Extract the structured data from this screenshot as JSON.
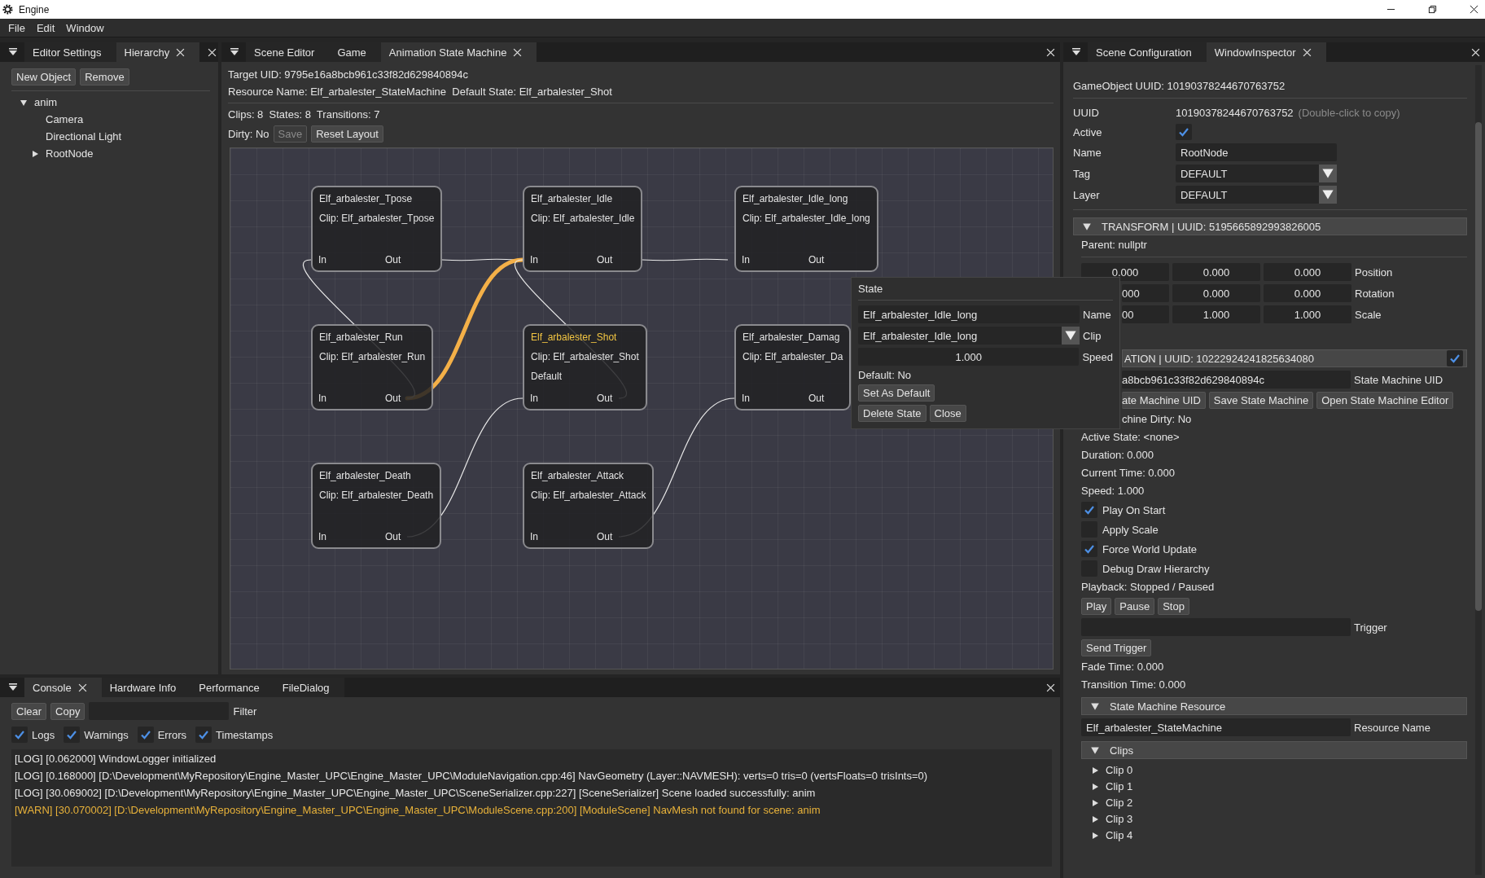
{
  "window": {
    "title": "Engine"
  },
  "menu": [
    "File",
    "Edit",
    "Window"
  ],
  "left_panel": {
    "tabs": [
      {
        "label": "Editor Settings",
        "selected": false,
        "closable": false
      },
      {
        "label": "Hierarchy",
        "selected": true,
        "closable": true
      }
    ],
    "buttons": [
      "New Object",
      "Remove"
    ],
    "tree": [
      {
        "label": "anim",
        "expanded": true,
        "children": [
          {
            "label": "Camera"
          },
          {
            "label": "Directional Light"
          },
          {
            "label": "RootNode",
            "expanded": false
          }
        ]
      }
    ]
  },
  "center_panel": {
    "tabs": [
      {
        "label": "Scene Editor",
        "selected": false,
        "closable": false
      },
      {
        "label": "Game",
        "selected": false,
        "closable": false
      },
      {
        "label": "Animation State Machine",
        "selected": true,
        "closable": true
      }
    ],
    "target_uid": "Target UID: 9795e16a8bcb961c33f82d629840894c",
    "resource_line": "Resource Name: Elf_arbalester_StateMachine  Default State: Elf_arbalester_Shot",
    "counts": "Clips: 8  States: 8  Transitions: 7",
    "dirty": "Dirty: No",
    "buttons": [
      {
        "label": "Save",
        "disabled": true
      },
      {
        "label": "Reset Layout",
        "disabled": false
      }
    ],
    "graph": {
      "nodes": [
        {
          "name": "Elf_arbalester_Tpose",
          "clip": "Clip: Elf_arbalester_Tpose",
          "highlighted": false,
          "in": "In",
          "out": "Out"
        },
        {
          "name": "Elf_arbalester_Idle",
          "clip": "Clip: Elf_arbalester_Idle",
          "highlighted": false,
          "in": "In",
          "out": "Out"
        },
        {
          "name": "Elf_arbalester_Idle_long",
          "clip": "Clip: Elf_arbalester_Idle_long",
          "highlighted": false,
          "in": "In",
          "out": "Out"
        },
        {
          "name": "Elf_arbalester_Run",
          "clip": "Clip: Elf_arbalester_Run",
          "highlighted": false,
          "in": "In",
          "out": "Out"
        },
        {
          "name": "Elf_arbalester_Shot",
          "clip": "Clip: Elf_arbalester_Shot",
          "note": "Default",
          "highlighted": true,
          "in": "In",
          "out": "Out"
        },
        {
          "name": "Elf_arbalester_Damag",
          "clip": "Clip: Elf_arbalester_Da",
          "highlighted": false,
          "in": "In",
          "out": "Out"
        },
        {
          "name": "Elf_arbalester_Death",
          "clip": "Clip: Elf_arbalester_Death",
          "highlighted": false,
          "in": "In",
          "out": "Out"
        },
        {
          "name": "Elf_arbalester_Attack",
          "clip": "Clip: Elf_arbalester_Attack",
          "highlighted": false,
          "in": "In",
          "out": "Out"
        }
      ],
      "transitions": [
        {
          "selected": false
        },
        {
          "selected": false
        },
        {
          "selected": true
        },
        {
          "selected": false
        },
        {
          "selected": false
        },
        {
          "selected": false
        },
        {
          "selected": false
        }
      ]
    }
  },
  "state_popup": {
    "title": "State",
    "name_value": "Elf_arbalester_Idle_long",
    "name_label": "Name",
    "clip_value": "Elf_arbalester_Idle_long",
    "clip_label": "Clip",
    "speed_value": "1.000",
    "speed_label": "Speed",
    "default_text": "Default: No",
    "buttons": [
      "Set As Default",
      "Delete State",
      "Close"
    ]
  },
  "right_panel": {
    "tabs": [
      {
        "label": "Scene Configuration",
        "selected": false,
        "closable": false
      },
      {
        "label": "WindowInspector",
        "selected": true,
        "closable": true
      }
    ],
    "gameobject_uuid": "GameObject UUID: 10190378244670763752",
    "uuid": {
      "label": "UUID",
      "value": "10190378244670763752",
      "hint": "(Double-click to copy)"
    },
    "active": {
      "label": "Active",
      "checked": true
    },
    "name": {
      "label": "Name",
      "value": "RootNode"
    },
    "tag": {
      "label": "Tag",
      "value": "DEFAULT"
    },
    "layer": {
      "label": "Layer",
      "value": "DEFAULT"
    },
    "transform": {
      "title": "TRANSFORM | UUID: 5195665892993826005",
      "expanded": true,
      "parent": "Parent: nullptr",
      "rows": [
        {
          "label": "Position",
          "values": [
            "0.000",
            "0.000",
            "0.000"
          ]
        },
        {
          "label": "Rotation",
          "values": [
            "000",
            "0.000",
            "0.000"
          ]
        },
        {
          "label": "Scale",
          "values": [
            "00",
            "1.000",
            "1.000"
          ]
        }
      ]
    },
    "animation": {
      "title": "ATION | UUID: 10222924241825634080",
      "enabled": true,
      "uid_value": "a8bcb961c33f82d629840894c",
      "uid_label": "State Machine UID",
      "buttons": [
        "ate Machine UID",
        "Save State Machine",
        "Open State Machine Editor"
      ],
      "lines": [
        "chine Dirty: No",
        "Active State: <none>",
        "Duration: 0.000",
        "Current Time: 0.000",
        "Speed: 1.000"
      ],
      "options": [
        {
          "label": "Play On Start",
          "checked": true
        },
        {
          "label": "Apply Scale",
          "checked": false
        },
        {
          "label": "Force World Update",
          "checked": true
        },
        {
          "label": "Debug Draw Hierarchy",
          "checked": false
        }
      ],
      "playback": "Playback: Stopped / Paused",
      "playback_buttons": [
        "Play",
        "Pause",
        "Stop"
      ],
      "trigger_label": "Trigger",
      "send_button": "Send Trigger",
      "times": [
        "Fade Time: 0.000",
        "Transition Time: 0.000"
      ],
      "resource": {
        "title": "State Machine Resource",
        "expanded": true,
        "value": "Elf_arbalester_StateMachine",
        "label": "Resource Name"
      },
      "clips": {
        "title": "Clips",
        "expanded": true,
        "items": [
          {
            "label": "Clip 0",
            "expanded": false
          },
          {
            "label": "Clip 1",
            "expanded": false
          },
          {
            "label": "Clip 2",
            "expanded": false
          },
          {
            "label": "Clip 3",
            "expanded": false
          },
          {
            "label": "Clip 4",
            "expanded": false
          }
        ]
      }
    }
  },
  "console": {
    "tabs": [
      {
        "label": "Console",
        "selected": true,
        "closable": true
      },
      {
        "label": "Hardware Info",
        "selected": false,
        "closable": false
      },
      {
        "label": "Performance",
        "selected": false,
        "closable": false
      },
      {
        "label": "FileDialog",
        "selected": false,
        "closable": false
      }
    ],
    "buttons": [
      "Clear",
      "Copy"
    ],
    "filter_label": "Filter",
    "filters": [
      {
        "label": "Logs",
        "checked": true
      },
      {
        "label": "Warnings",
        "checked": true
      },
      {
        "label": "Errors",
        "checked": true
      },
      {
        "label": "Timestamps",
        "checked": true
      }
    ],
    "lines": [
      {
        "kind": "log",
        "text": "[LOG] [0.062000] WindowLogger initialized"
      },
      {
        "kind": "log",
        "text": "[LOG] [0.168000] [D:\\Development\\MyRepository\\Engine_Master_UPC\\Engine_Master_UPC\\ModuleNavigation.cpp:46] NavGeometry (Layer::NAVMESH): verts=0 tris=0 (vertsFloats=0 trisInts=0)"
      },
      {
        "kind": "log",
        "text": "[LOG] [30.069002] [D:\\Development\\MyRepository\\Engine_Master_UPC\\Engine_Master_UPC\\SceneSerializer.cpp:227] [SceneSerializer] Scene loaded successfully: anim"
      },
      {
        "kind": "warn",
        "text": "[WARN] [30.070002] [D:\\Development\\MyRepository\\Engine_Master_UPC\\Engine_Master_UPC\\ModuleScene.cpp:200] [ModuleScene] NavMesh not found for scene: anim"
      }
    ]
  }
}
